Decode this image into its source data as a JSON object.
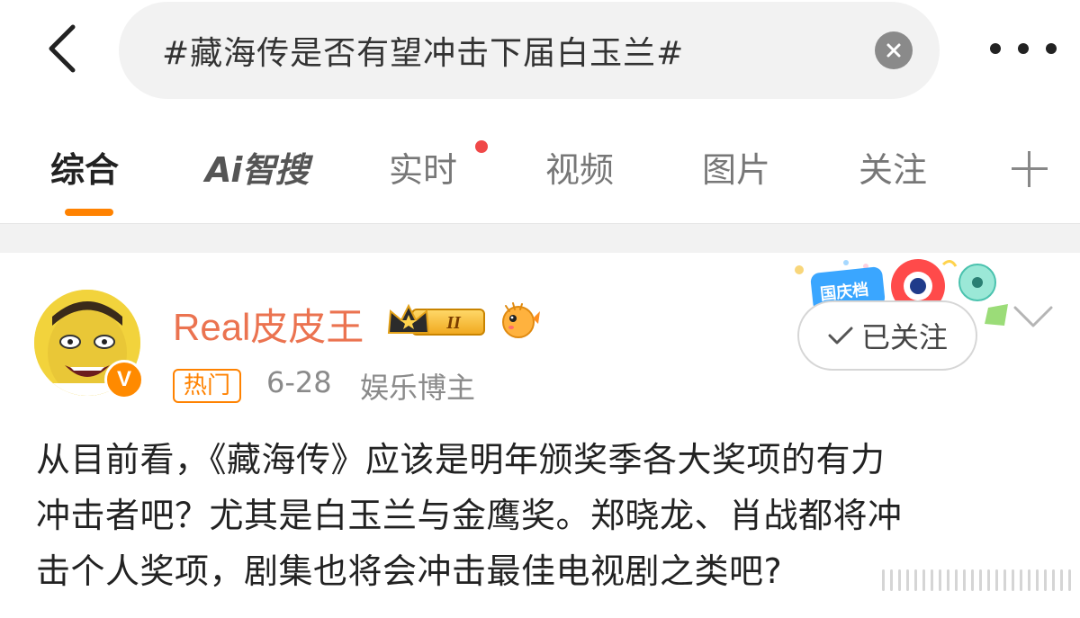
{
  "search": {
    "query": "#藏海传是否有望冲击下届白玉兰#"
  },
  "icons": {
    "back": "back-arrow-icon",
    "clear": "clear-icon",
    "more": "more-icon",
    "plus": "plus-icon",
    "check": "check-icon",
    "chevron": "chevron-down-icon"
  },
  "tabs": [
    {
      "label": "综合",
      "active": true
    },
    {
      "label": "Ai智搜",
      "active": false
    },
    {
      "label": "实时",
      "active": false,
      "has_dot": true
    },
    {
      "label": "视频",
      "active": false
    },
    {
      "label": "图片",
      "active": false
    },
    {
      "label": "关注",
      "active": false
    }
  ],
  "post": {
    "author": {
      "name": "Real皮皮王",
      "verified_mark": "V",
      "level_badge": "II",
      "festival_badge": "国庆档"
    },
    "hot_tag": "热门",
    "date": "6-28",
    "role": "娱乐博主",
    "follow_label": "已关注",
    "body_lines": [
      "从目前看，《藏海传》应该是明年颁奖季各大奖项的有力",
      "冲击者吧？尤其是白玉兰与金鹰奖。郑晓龙、肖战都将冲",
      "击个人奖项，剧集也将会冲击最佳电视剧之类吧?"
    ]
  },
  "colors": {
    "accent": "#ff8200",
    "username": "#eb7350",
    "notification_dot": "#f04848"
  }
}
